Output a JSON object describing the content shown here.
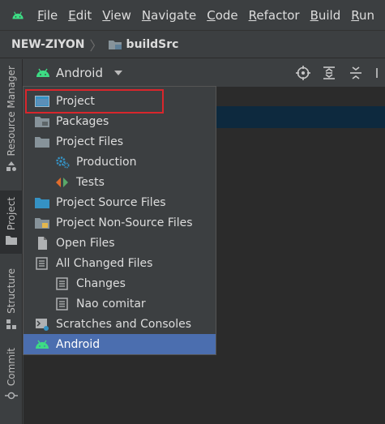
{
  "menubar": {
    "items": [
      {
        "label": "File",
        "mnemonic": "F",
        "rest": "ile"
      },
      {
        "label": "Edit",
        "mnemonic": "E",
        "rest": "dit"
      },
      {
        "label": "View",
        "mnemonic": "V",
        "rest": "iew"
      },
      {
        "label": "Navigate",
        "mnemonic": "N",
        "rest": "avigate"
      },
      {
        "label": "Code",
        "mnemonic": "C",
        "rest": "ode"
      },
      {
        "label": "Refactor",
        "mnemonic": "R",
        "rest": "efactor"
      },
      {
        "label": "Build",
        "mnemonic": "B",
        "rest": "uild"
      },
      {
        "label": "Run",
        "mnemonic": "R",
        "rest": "un"
      }
    ]
  },
  "breadcrumb": {
    "project": "NEW-ZIYON",
    "directory": "buildSrc"
  },
  "stripe": {
    "resource_manager": "Resource Manager",
    "project": "Project",
    "structure": "Structure",
    "commit": "Commit"
  },
  "toolwindow": {
    "view_selected": "Android"
  },
  "popup": {
    "items": [
      {
        "label": "Project",
        "icon": "project-window-icon",
        "indent": 0
      },
      {
        "label": "Packages",
        "icon": "packages-folder-icon",
        "indent": 0
      },
      {
        "label": "Project Files",
        "icon": "folder-icon",
        "indent": 0
      },
      {
        "label": "Production",
        "icon": "gear-icon",
        "indent": 1
      },
      {
        "label": "Tests",
        "icon": "tests-arrows-icon",
        "indent": 1
      },
      {
        "label": "Project Source Files",
        "icon": "source-folder-icon",
        "indent": 0
      },
      {
        "label": "Project Non-Source Files",
        "icon": "non-source-folder-icon",
        "indent": 0
      },
      {
        "label": "Open Files",
        "icon": "file-icon",
        "indent": 0
      },
      {
        "label": "All Changed Files",
        "icon": "changelist-icon",
        "indent": 0
      },
      {
        "label": "Changes",
        "icon": "changelist-icon",
        "indent": 1
      },
      {
        "label": "Nao comitar",
        "icon": "changelist-icon",
        "indent": 1
      },
      {
        "label": "Scratches and Consoles",
        "icon": "scratches-icon",
        "indent": 0
      },
      {
        "label": "Android",
        "icon": "android-icon",
        "indent": 0
      }
    ],
    "selected": "Android",
    "highlighted": "Project"
  },
  "colors": {
    "background": "#3c3f41",
    "tree_background": "#2b2b2b",
    "selection": "#4b6eaf",
    "highlight_border": "#d9262c",
    "android_green": "#3ddc84"
  }
}
